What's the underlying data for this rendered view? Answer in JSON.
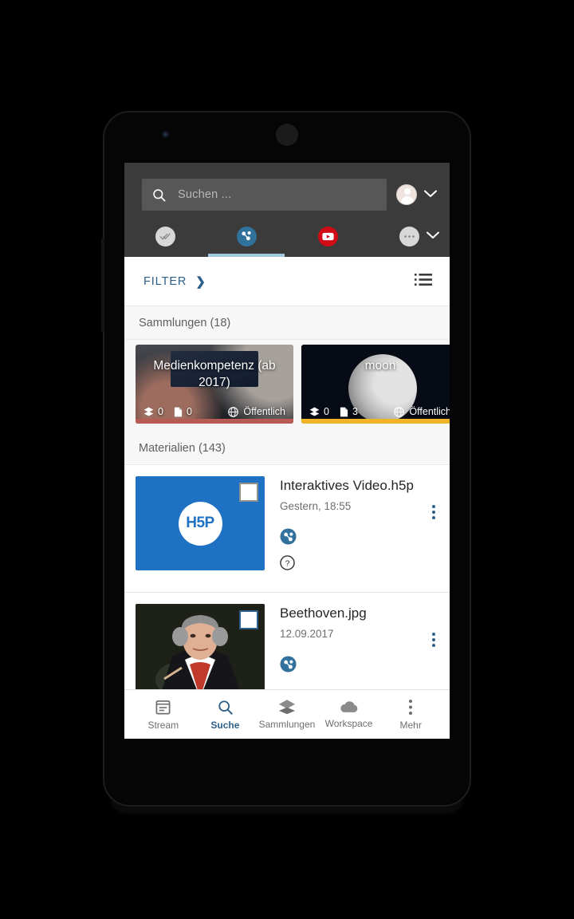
{
  "app": {
    "search": {
      "placeholder": "Suchen ...",
      "value": ""
    },
    "account": {
      "chevron_icon": "chevron-down-icon",
      "avatar_icon": "avatar-icon"
    },
    "source_tabs": [
      {
        "id": "check",
        "icon": "checkmark-circle-icon",
        "color": "#d8d8d8",
        "active": false
      },
      {
        "id": "edusharing",
        "icon": "edu-sharing-logo-icon",
        "color": "#31719b",
        "active": true
      },
      {
        "id": "youtube",
        "icon": "youtube-icon",
        "color": "#d10b16",
        "active": false
      },
      {
        "id": "more",
        "icon": "ellipsis-circle-icon",
        "color": "#d8d8d8",
        "active": false
      }
    ],
    "tabs_chevron_icon": "chevron-down-icon"
  },
  "filterbar": {
    "label": "FILTER",
    "arrow": "❯",
    "view_toggle_icon": "list-view-icon"
  },
  "collections_section": {
    "header": "Sammlungen (18)",
    "items": [
      {
        "title": "Medienkompetenz (ab 2017)",
        "collections_count": "0",
        "materials_count": "0",
        "visibility": "Öffentlich",
        "accent": "#b95b55",
        "thumb": "laptop-photo"
      },
      {
        "title": "moon",
        "collections_count": "0",
        "materials_count": "3",
        "visibility": "Öffentlich",
        "accent": "#f0b429",
        "thumb": "moon-photo"
      }
    ],
    "layers_icon": "layers-icon",
    "file_icon": "file-icon",
    "globe_icon": "globe-icon"
  },
  "materials_section": {
    "header": "Materialien (143)",
    "items": [
      {
        "title": "Interaktives Video.h5p",
        "date": "Gestern, 18:55",
        "thumb": "h5p-logo",
        "thumb_text": "H5P",
        "thumb_color": "#1f71c4",
        "checkbox_checked": false,
        "badges": [
          "edu-sharing-badge-icon",
          "question-mark-icon"
        ],
        "menu_icon": "kebab-menu-icon"
      },
      {
        "title": "Beethoven.jpg",
        "date": "12.09.2017",
        "thumb": "beethoven-portrait",
        "checkbox_checked": false,
        "badges": [
          "edu-sharing-badge-icon"
        ],
        "menu_icon": "kebab-menu-icon"
      }
    ]
  },
  "bottom_nav": {
    "items": [
      {
        "label": "Stream",
        "icon": "stream-icon",
        "active": false
      },
      {
        "label": "Suche",
        "icon": "search-icon",
        "active": true
      },
      {
        "label": "Sammlungen",
        "icon": "layers-icon",
        "active": false
      },
      {
        "label": "Workspace",
        "icon": "cloud-icon",
        "active": false
      },
      {
        "label": "Mehr",
        "icon": "kebab-menu-icon",
        "active": false
      }
    ],
    "accent_color": "#2c5f8a"
  }
}
